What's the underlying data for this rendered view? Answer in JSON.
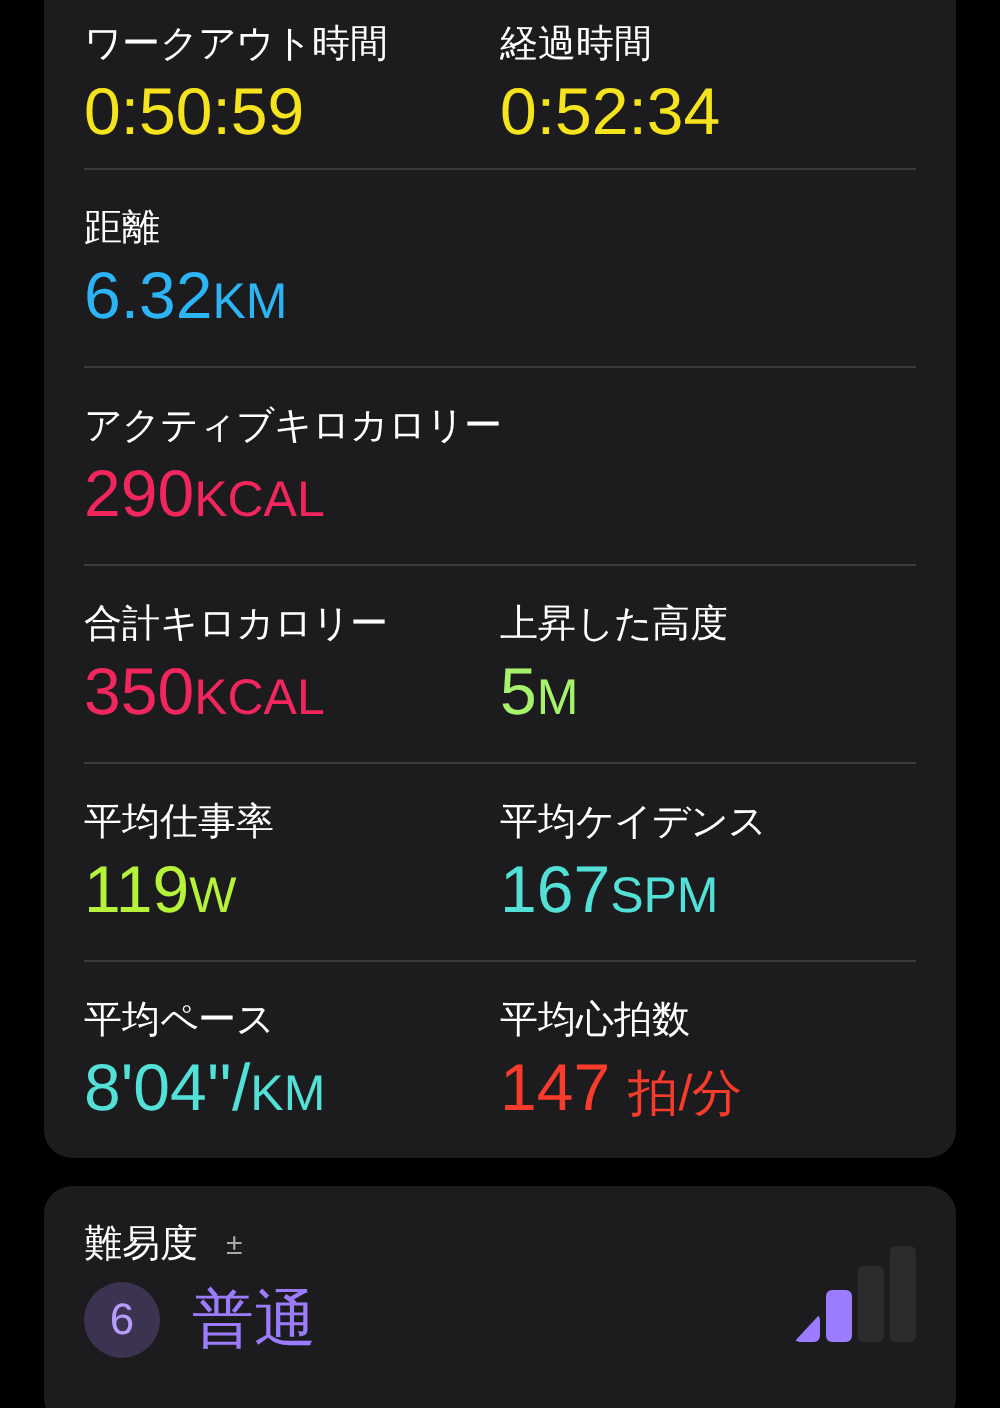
{
  "metrics_rows": [
    {
      "items": [
        {
          "label": "ワークアウト時間",
          "value": "0:50:59",
          "color": "#f5e31d"
        },
        {
          "label": "経過時間",
          "value": "0:52:34",
          "color": "#f5e31d"
        }
      ]
    },
    {
      "items": [
        {
          "label": "距離",
          "value": "6.32",
          "unit": "KM",
          "color": "#2db4f5"
        }
      ]
    },
    {
      "items": [
        {
          "label": "アクティブキロカロリー",
          "value": "290",
          "unit": "KCAL",
          "color": "#f1265c"
        }
      ]
    },
    {
      "items": [
        {
          "label": "合計キロカロリー",
          "value": "350",
          "unit": "KCAL",
          "color": "#f1265c"
        },
        {
          "label": "上昇した高度",
          "value": "5",
          "unit": "M",
          "color": "#a6f26a"
        }
      ]
    },
    {
      "items": [
        {
          "label": "平均仕事率",
          "value": "119",
          "unit": "W",
          "color": "#b7f23a"
        },
        {
          "label": "平均ケイデンス",
          "value": "167",
          "unit": "SPM",
          "color": "#53e0d6"
        }
      ]
    },
    {
      "items": [
        {
          "label": "平均ペース",
          "value": "8'04''/",
          "unit": "KM",
          "color": "#53e0d6"
        },
        {
          "label": "平均心拍数",
          "value": "147 ",
          "unit": "拍/分",
          "color": "#fb3b2c"
        }
      ]
    }
  ],
  "difficulty": {
    "label": "難易度",
    "symbol": "±",
    "score": "6",
    "text": "普通"
  }
}
